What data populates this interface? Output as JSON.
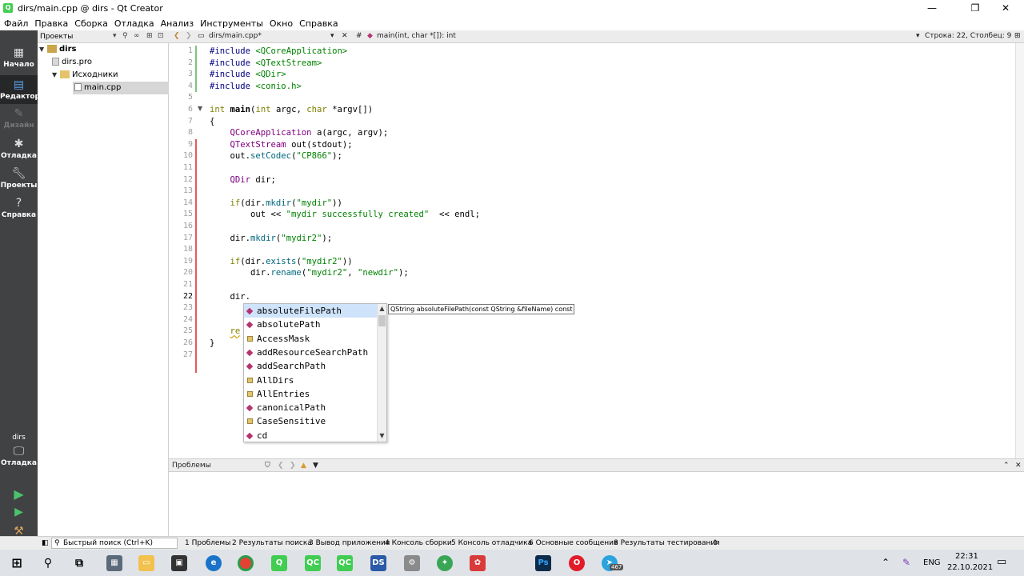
{
  "window": {
    "title": "dirs/main.cpp @ dirs - Qt Creator",
    "controls": {
      "minimize": "—",
      "maximize": "❐",
      "close": "✕"
    }
  },
  "menu": [
    "Файл",
    "Правка",
    "Сборка",
    "Отладка",
    "Анализ",
    "Инструменты",
    "Окно",
    "Справка"
  ],
  "modes": [
    {
      "label": "Начало",
      "icon": "grid-icon"
    },
    {
      "label": "Редактор",
      "icon": "editor-icon",
      "active": true
    },
    {
      "label": "Дизайн",
      "icon": "design-icon",
      "disabled": true
    },
    {
      "label": "Отладка",
      "icon": "bug-icon"
    },
    {
      "label": "Проекты",
      "icon": "wrench-icon"
    },
    {
      "label": "Справка",
      "icon": "help-icon"
    }
  ],
  "kit": {
    "project": "dirs",
    "mode": "Отладка"
  },
  "projects_pane": {
    "title": "Проекты",
    "tree": [
      {
        "label": "dirs",
        "level": 0,
        "expanded": true,
        "bold": true
      },
      {
        "label": "dirs.pro",
        "level": 1
      },
      {
        "label": "Исходники",
        "level": 1,
        "expanded": true
      },
      {
        "label": "main.cpp",
        "level": 2,
        "selected": true
      }
    ]
  },
  "editor_toolbar": {
    "file": "dirs/main.cpp*",
    "symbol_hash": "#",
    "function": "main(int, char *[]): int",
    "position": "Строка: 22, Столбец: 9"
  },
  "editor": {
    "current_line": 22,
    "lines": [
      "#include <QCoreApplication>",
      "#include <QTextStream>",
      "#include <QDir>",
      "#include <conio.h>",
      "",
      "int main(int argc, char *argv[])",
      "{",
      "    QCoreApplication a(argc, argv);",
      "    QTextStream out(stdout);",
      "    out.setCodec(\"CP866\");",
      "",
      "    QDir dir;",
      "",
      "    if(dir.mkdir(\"mydir\"))",
      "        out << \"mydir successfully created\"  << endl;",
      "",
      "    dir.mkdir(\"mydir2\");",
      "",
      "    if(dir.exists(\"mydir2\"))",
      "        dir.rename(\"mydir2\", \"newdir\");",
      "",
      "    dir.",
      "",
      "",
      "    re",
      "}",
      ""
    ]
  },
  "completion": {
    "items": [
      {
        "label": "absoluteFilePath",
        "kind": "method",
        "selected": true
      },
      {
        "label": "absolutePath",
        "kind": "method"
      },
      {
        "label": "AccessMask",
        "kind": "enum"
      },
      {
        "label": "addResourceSearchPath",
        "kind": "method"
      },
      {
        "label": "addSearchPath",
        "kind": "method"
      },
      {
        "label": "AllDirs",
        "kind": "enum"
      },
      {
        "label": "AllEntries",
        "kind": "enum"
      },
      {
        "label": "canonicalPath",
        "kind": "method"
      },
      {
        "label": "CaseSensitive",
        "kind": "enum"
      },
      {
        "label": "cd",
        "kind": "method"
      }
    ],
    "tooltip": "QString absoluteFilePath(const QString &fileName) const"
  },
  "output_pane": {
    "title": "Проблемы"
  },
  "statusbar": {
    "search_placeholder": "Быстрый поиск (Ctrl+K)",
    "tabs": [
      "1 Проблемы",
      "2 Результаты поиска",
      "3 Вывод приложения",
      "4 Консоль сборки",
      "5 Консоль отладчика",
      "6 Основные сообщения",
      "8 Результаты тестирования"
    ]
  },
  "taskbar": {
    "apps": [
      "start",
      "search",
      "task-view",
      "calculator",
      "explorer",
      "store",
      "edge",
      "chrome",
      "qt-creator",
      "qt-designer",
      "qt-linguist",
      "ds",
      "network",
      "android",
      "game",
      "photoshop",
      "opera",
      "telegram"
    ],
    "telegram_badge": "467",
    "lang": "ENG",
    "time": "22:31",
    "date": "22.10.2021"
  }
}
